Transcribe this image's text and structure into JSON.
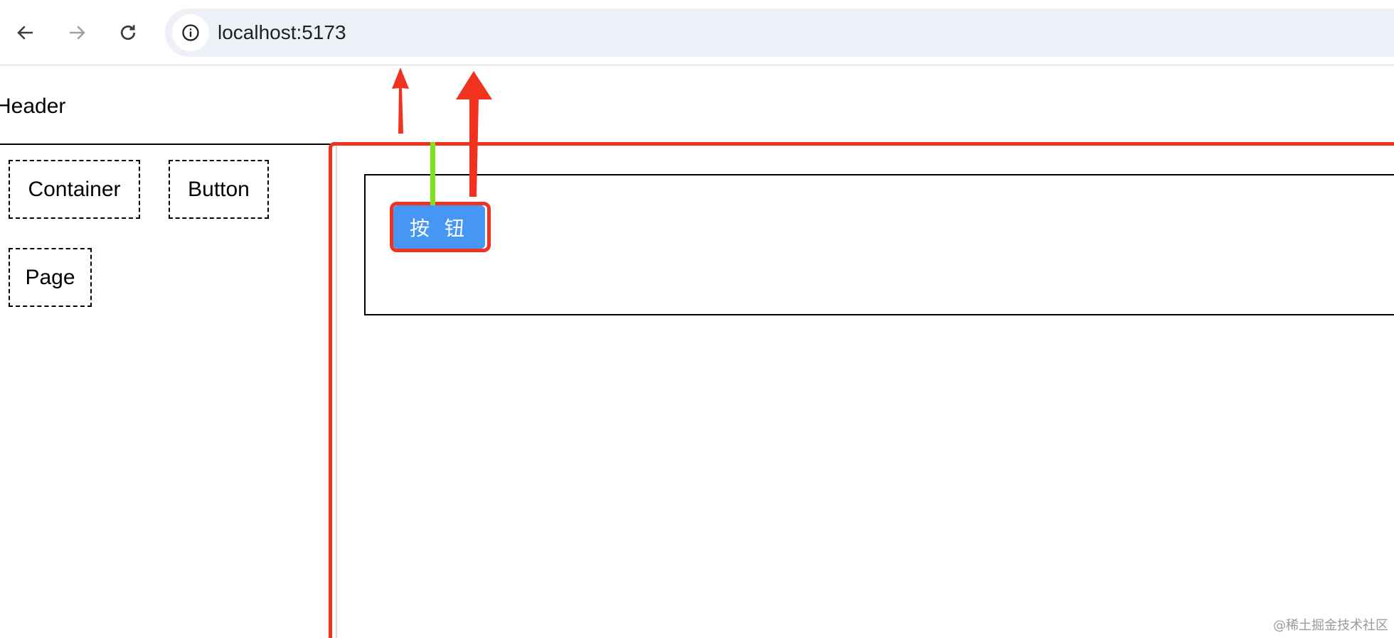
{
  "browser": {
    "back_icon": "arrow-left-icon",
    "forward_icon": "arrow-right-icon",
    "reload_icon": "reload-icon",
    "site_info_icon": "info-circle-icon",
    "url": "localhost:5173"
  },
  "page": {
    "header_label": "Header",
    "materials": [
      {
        "label": "Container"
      },
      {
        "label": "Button"
      },
      {
        "label": "Page"
      }
    ],
    "canvas": {
      "button_label": "按 钮"
    }
  },
  "annotations": {
    "outline_color": "#f0321e",
    "arrow_color": "#f0321e",
    "marker_color": "#7ee01e"
  },
  "watermark": "@稀土掘金技术社区"
}
